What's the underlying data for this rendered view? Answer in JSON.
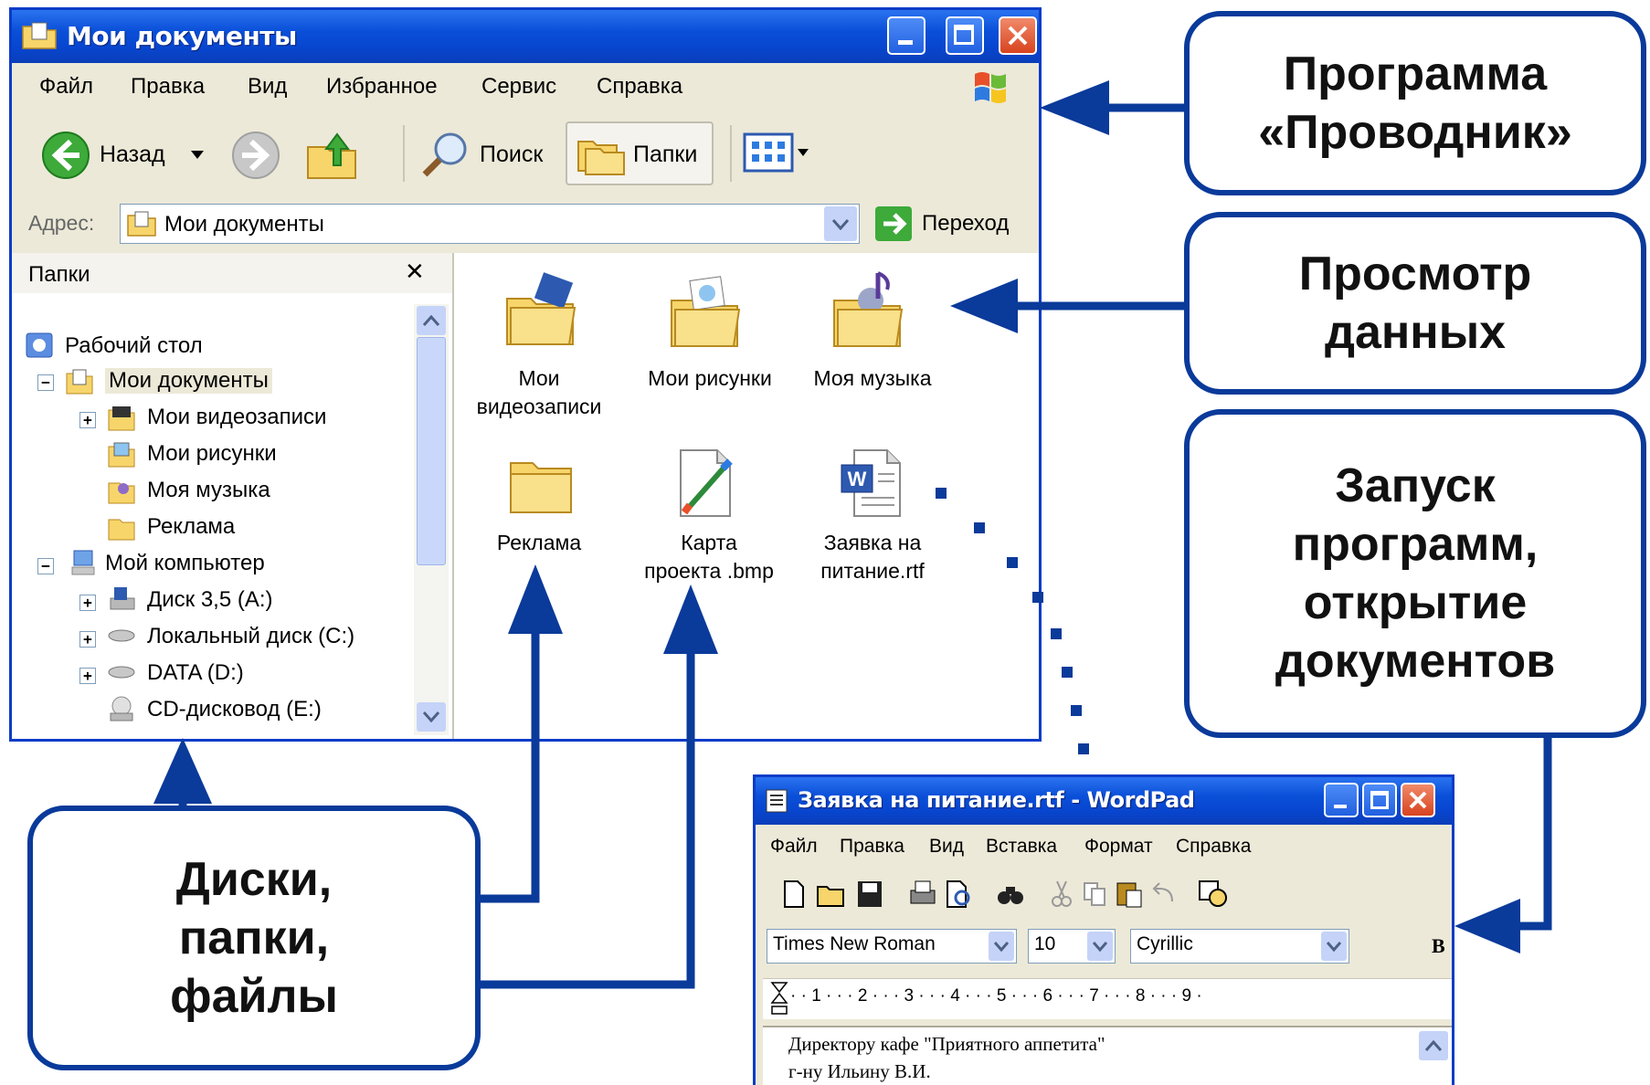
{
  "explorer": {
    "title": "Мои документы",
    "menu": [
      "Файл",
      "Правка",
      "Вид",
      "Избранное",
      "Сервис",
      "Справка"
    ],
    "toolbar": {
      "back": "Назад",
      "search": "Поиск",
      "folders": "Папки"
    },
    "address": {
      "label": "Адрес:",
      "value": "Мои документы",
      "go": "Переход"
    },
    "folders_pane": {
      "title": "Папки",
      "close_glyph": "✕",
      "tree": [
        "Рабочий стол",
        "Мои документы",
        "Мои видеозаписи",
        "Мои рисунки",
        "Моя музыка",
        "Реклама",
        "Мой компьютер",
        "Диск 3,5 (A:)",
        "Локальный диск (C:)",
        "DATA (D:)",
        "CD-дисковод (E:)"
      ]
    },
    "files": [
      {
        "line1": "Мои",
        "line2": "видеозаписи"
      },
      {
        "line1": "Мои рисунки",
        "line2": ""
      },
      {
        "line1": "Моя музыка",
        "line2": ""
      },
      {
        "line1": "Реклама",
        "line2": ""
      },
      {
        "line1": "Карта",
        "line2": "проекта .bmp"
      },
      {
        "line1": "Заявка на",
        "line2": "питание.rtf"
      }
    ]
  },
  "callouts": {
    "explorer": "Программа\n«Проводник»",
    "view": "Просмотр\nданных",
    "launch": "Запуск\nпрограмм,\nоткрытие\nдокументов",
    "disks": "Диски,\nпапки,\nфайлы"
  },
  "wordpad": {
    "title": "Заявка на питание.rtf - WordPad",
    "menu": [
      "Файл",
      "Правка",
      "Вид",
      "Вставка",
      "Формат",
      "Справка"
    ],
    "font": "Times New Roman",
    "size": "10",
    "script": "Cyrillic",
    "bold": "B",
    "ruler": "· · 1 · · · 2 · · · 3 · · · 4 · · · 5 · · · 6 · · · 7 · · · 8 · · · 9 ·",
    "doc_lines": [
      "Директору кафе \"Приятного аппетита\"",
      "г-ну Ильину В.И."
    ]
  },
  "colors": {
    "xp_blue": "#0A3CC8",
    "callout_border": "#0A3A9A",
    "arrow": "#0A3A9A",
    "chrome": "#ECE9D8"
  }
}
